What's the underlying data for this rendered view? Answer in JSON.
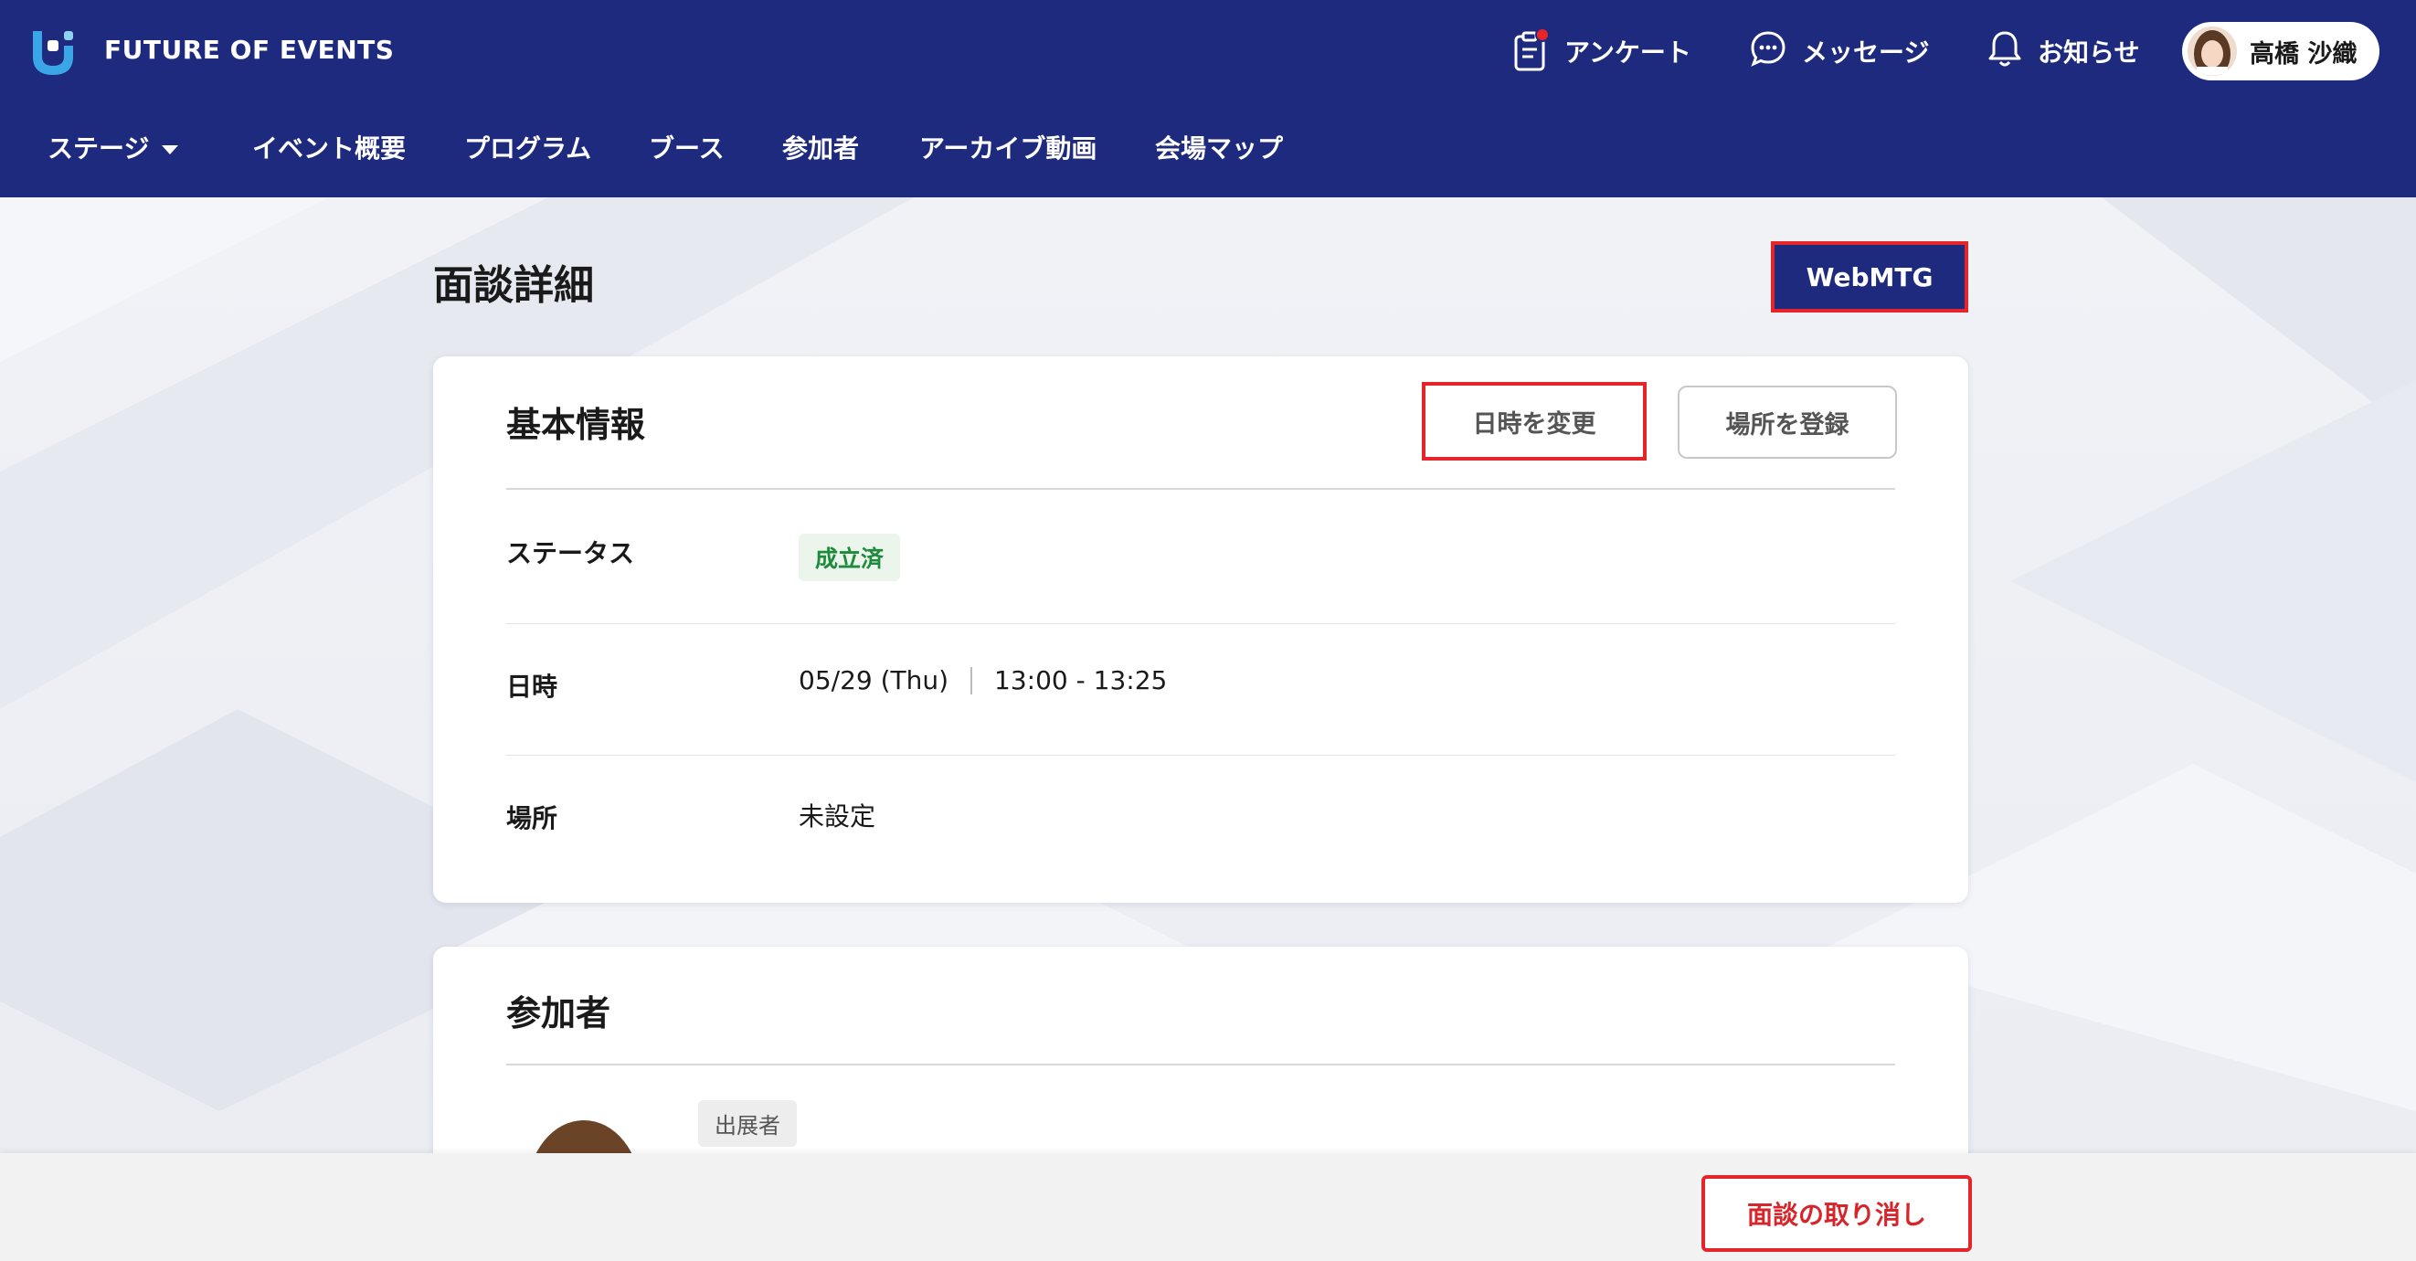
{
  "header": {
    "brand": "FUTURE OF EVENTS",
    "top_nav": [
      {
        "label": "アンケート",
        "icon": "survey-icon",
        "has_badge": true
      },
      {
        "label": "メッセージ",
        "icon": "message-icon"
      },
      {
        "label": "お知らせ",
        "icon": "bell-icon"
      }
    ],
    "user": {
      "name": "高橋 沙織"
    },
    "main_nav": [
      {
        "label": "ステージ",
        "has_dropdown": true
      },
      {
        "label": "イベント概要"
      },
      {
        "label": "プログラム"
      },
      {
        "label": "ブース"
      },
      {
        "label": "参加者"
      },
      {
        "label": "アーカイブ動画"
      },
      {
        "label": "会場マップ"
      }
    ]
  },
  "page": {
    "title": "面談詳細",
    "webmtg_label": "WebMTG"
  },
  "basic_info": {
    "title": "基本情報",
    "change_datetime_label": "日時を変更",
    "register_location_label": "場所を登録",
    "rows": {
      "status": {
        "label": "ステータス",
        "value": "成立済"
      },
      "datetime": {
        "label": "日時",
        "date": "05/29 (Thu)",
        "time": "13:00 - 13:25"
      },
      "location": {
        "label": "場所",
        "value": "未設定"
      }
    }
  },
  "participants": {
    "title": "参加者",
    "role_tag": "出展者"
  },
  "footer": {
    "cancel_label": "面談の取り消し"
  },
  "colors": {
    "header_bg": "#1e2a7d",
    "highlight": "#e6252b",
    "status_green": "#1e8a3c"
  }
}
